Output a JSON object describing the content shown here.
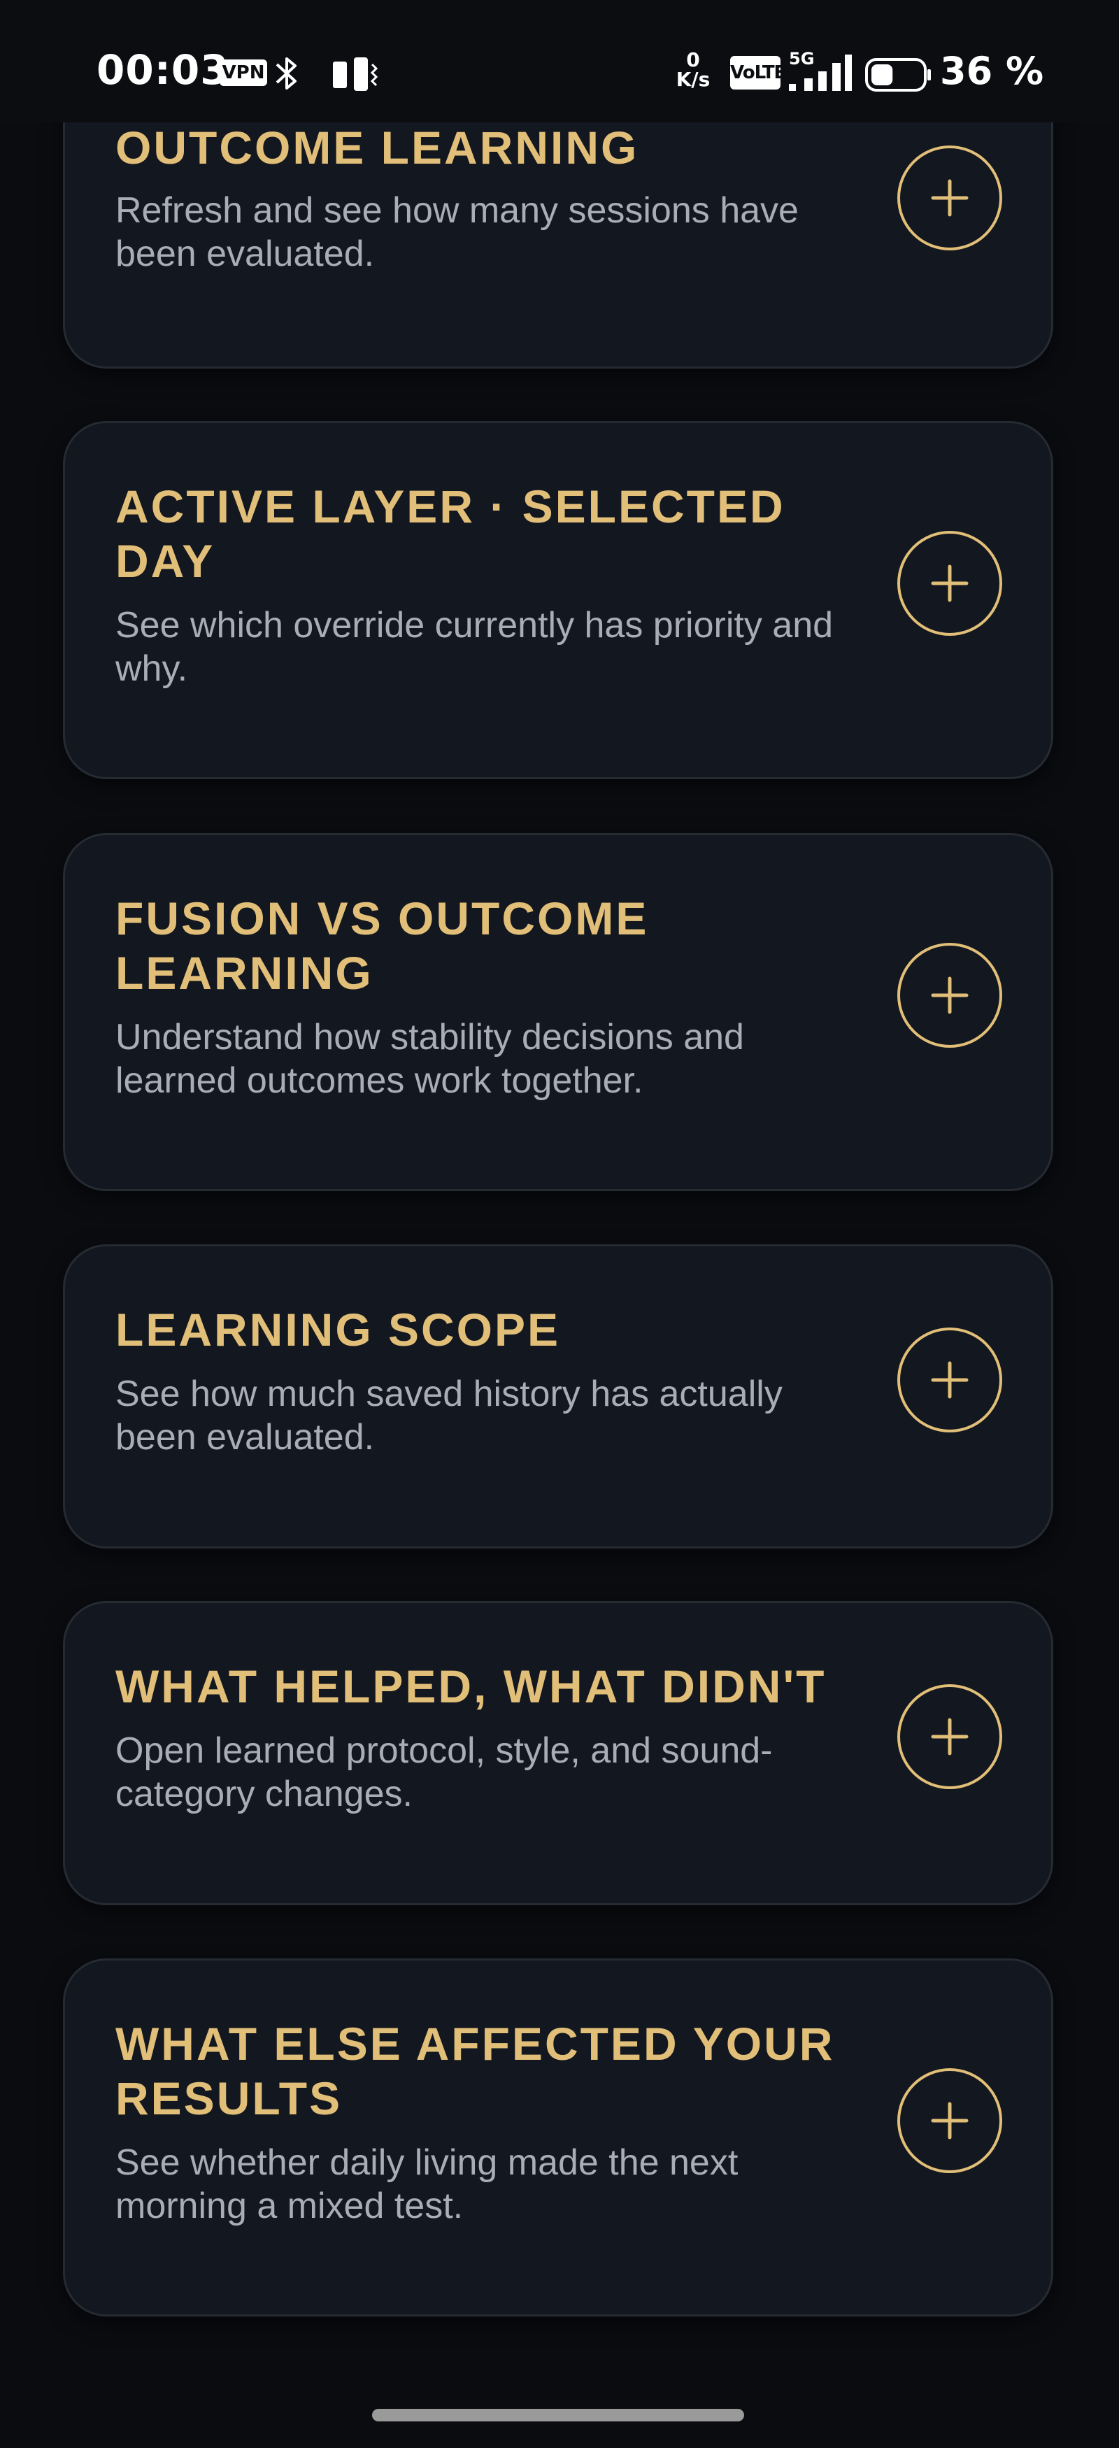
{
  "status_bar": {
    "time": "00:03",
    "vpn_label": "VPN",
    "net_speed_value": "0",
    "net_speed_unit": "K/s",
    "volte_label": "VoLTE",
    "network_type": "5G",
    "battery_percent": "36 %",
    "battery_level": 0.36
  },
  "cards": [
    {
      "title": "OUTCOME LEARNING",
      "description": "Refresh and see how many sessions have been evaluated."
    },
    {
      "title": "ACTIVE LAYER · SELECTED DAY",
      "description": "See which override currently has priority and why."
    },
    {
      "title": "FUSION VS OUTCOME LEARNING",
      "description": "Understand how stability decisions and learned outcomes work together."
    },
    {
      "title": "LEARNING SCOPE",
      "description": "See how much saved history has actually been evaluated."
    },
    {
      "title": "WHAT HELPED, WHAT DIDN'T",
      "description": "Open learned protocol, style, and sound-category changes."
    },
    {
      "title": "WHAT ELSE AFFECTED YOUR RESULTS",
      "description": "See whether daily living made the next morning a mixed test."
    }
  ],
  "icons": {
    "expand": "plus-icon"
  },
  "colors": {
    "accent_gold": "#e2bf78",
    "card_background": "#131720",
    "page_background": "#0a0c10",
    "description_text": "#a9adb6"
  }
}
